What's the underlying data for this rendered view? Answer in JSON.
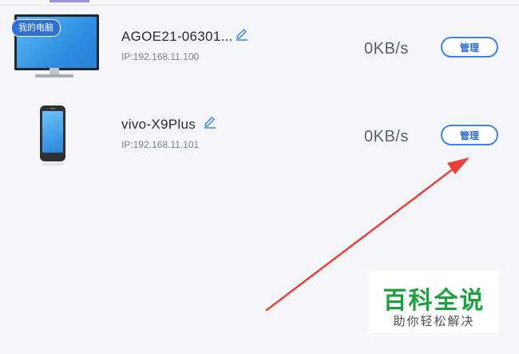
{
  "devices": [
    {
      "name": "AGOE21-06301...",
      "ip": "IP:192.168.11.100",
      "speed": "0KB/s",
      "manage_label": "管理",
      "badge": "我的电脑",
      "icon": "monitor-icon"
    },
    {
      "name": "vivo-X9Plus",
      "ip": "IP:192.168.11.101",
      "speed": "0KB/s",
      "manage_label": "管理",
      "icon": "phone-icon"
    }
  ],
  "watermark": {
    "title": "百科全说",
    "subtitle": "助你轻松解决"
  },
  "colors": {
    "accent": "#3f82e4",
    "arrow": "#e8413c",
    "watermark_green": "#1fa040"
  }
}
